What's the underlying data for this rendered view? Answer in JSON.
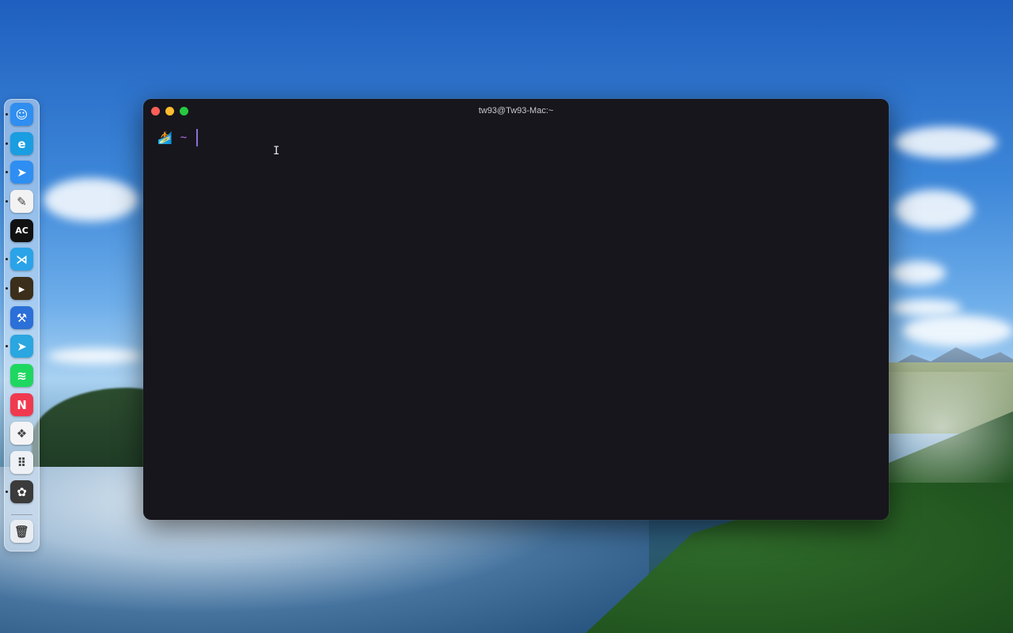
{
  "terminal": {
    "title": "tw93@Tw93-Mac:~",
    "prompt_icon": "🏄",
    "prompt_dir": "~"
  },
  "dock": {
    "items": [
      {
        "name": "finder",
        "glyph": "☺",
        "color": "#2f8ef0",
        "running": true
      },
      {
        "name": "edge",
        "glyph": "e",
        "color": "#1b9de2",
        "running": true
      },
      {
        "name": "paw",
        "glyph": "➤",
        "color": "#2e8ef2",
        "running": true
      },
      {
        "name": "cardinal",
        "glyph": "✎",
        "color": "#f2f2f2",
        "running": true
      },
      {
        "name": "ac",
        "glyph": "AC",
        "color": "#111111",
        "running": false
      },
      {
        "name": "vscode",
        "glyph": "⋊",
        "color": "#2aa3e8",
        "running": true
      },
      {
        "name": "terminal",
        "glyph": "▸",
        "color": "#3b2e1a",
        "running": true
      },
      {
        "name": "xcode",
        "glyph": "⚒",
        "color": "#2b6fd8",
        "running": false
      },
      {
        "name": "telegram",
        "glyph": "➤",
        "color": "#2aa6e0",
        "running": true
      },
      {
        "name": "spotify",
        "glyph": "≋",
        "color": "#1ed760",
        "running": false
      },
      {
        "name": "news",
        "glyph": "N",
        "color": "#f0394f",
        "running": false
      },
      {
        "name": "craft",
        "glyph": "❖",
        "color": "#f4f4f6",
        "running": false
      },
      {
        "name": "launchpad",
        "glyph": "⠿",
        "color": "#eef1f5",
        "running": false
      },
      {
        "name": "pixelmator",
        "glyph": "✿",
        "color": "#3b3b3b",
        "running": true
      },
      {
        "name": "trash",
        "glyph": "🗑",
        "color": "#e9edf2",
        "running": false
      }
    ]
  }
}
